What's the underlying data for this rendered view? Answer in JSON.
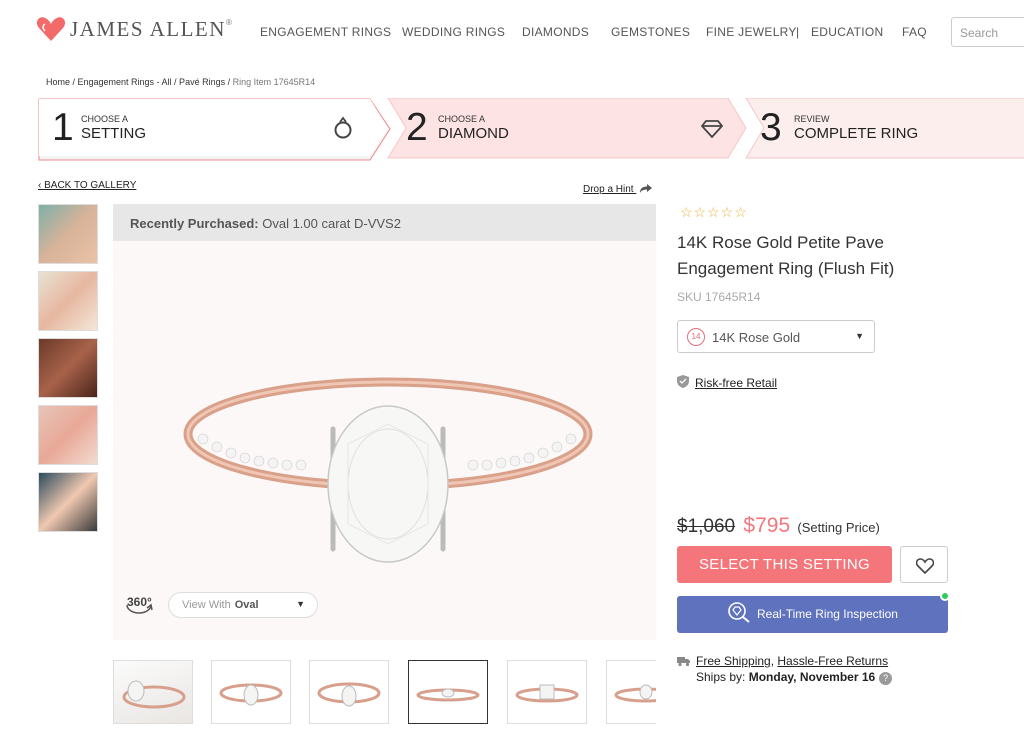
{
  "header": {
    "logo_text": "JAMES ALLEN",
    "logo_mark": "®",
    "nav": [
      "ENGAGEMENT RINGS",
      "WEDDING RINGS",
      "DIAMONDS",
      "GEMSTONES",
      "FINE JEWELRY",
      "|",
      "EDUCATION",
      "FAQ"
    ],
    "search_placeholder": "Search"
  },
  "breadcrumb": {
    "parts": [
      "Home / Engagement Rings - All / Pavé Rings / "
    ],
    "current": "Ring Item 17645R14"
  },
  "steps": [
    {
      "num": "1",
      "small": "CHOOSE A",
      "big": "SETTING"
    },
    {
      "num": "2",
      "small": "CHOOSE A",
      "big": "DIAMOND"
    },
    {
      "num": "3",
      "small": "REVIEW",
      "big": "COMPLETE RING"
    }
  ],
  "gallery": {
    "back_label": "BACK TO GALLERY",
    "hint_label": "Drop a Hint",
    "recent_label": "Recently Purchased:",
    "recent_value": "Oval 1.00 carat D-VVS2",
    "badge_360": "360°",
    "view_with_label": "View With",
    "view_with_value": "Oval"
  },
  "product": {
    "title": "14K Rose Gold Petite Pave Engagement Ring (Flush Fit)",
    "sku": "SKU 17645R14",
    "metal_badge": "14",
    "metal": "14K Rose Gold",
    "risk_free": "Risk-free Retail",
    "old_price": "$1,060",
    "price": "$795",
    "price_note": "(Setting Price)",
    "select_button": "SELECT THIS SETTING",
    "inspection_button": "Real-Time Ring Inspection",
    "free_shipping": "Free Shipping",
    "returns": "Hassle-Free Returns",
    "ships_by_label": "Ships by:",
    "ships_by_date": "Monday, November 16",
    "rating": 0
  },
  "colors": {
    "accent": "#f4767a",
    "inspect": "#5f72bd",
    "star": "#e7b43d"
  }
}
